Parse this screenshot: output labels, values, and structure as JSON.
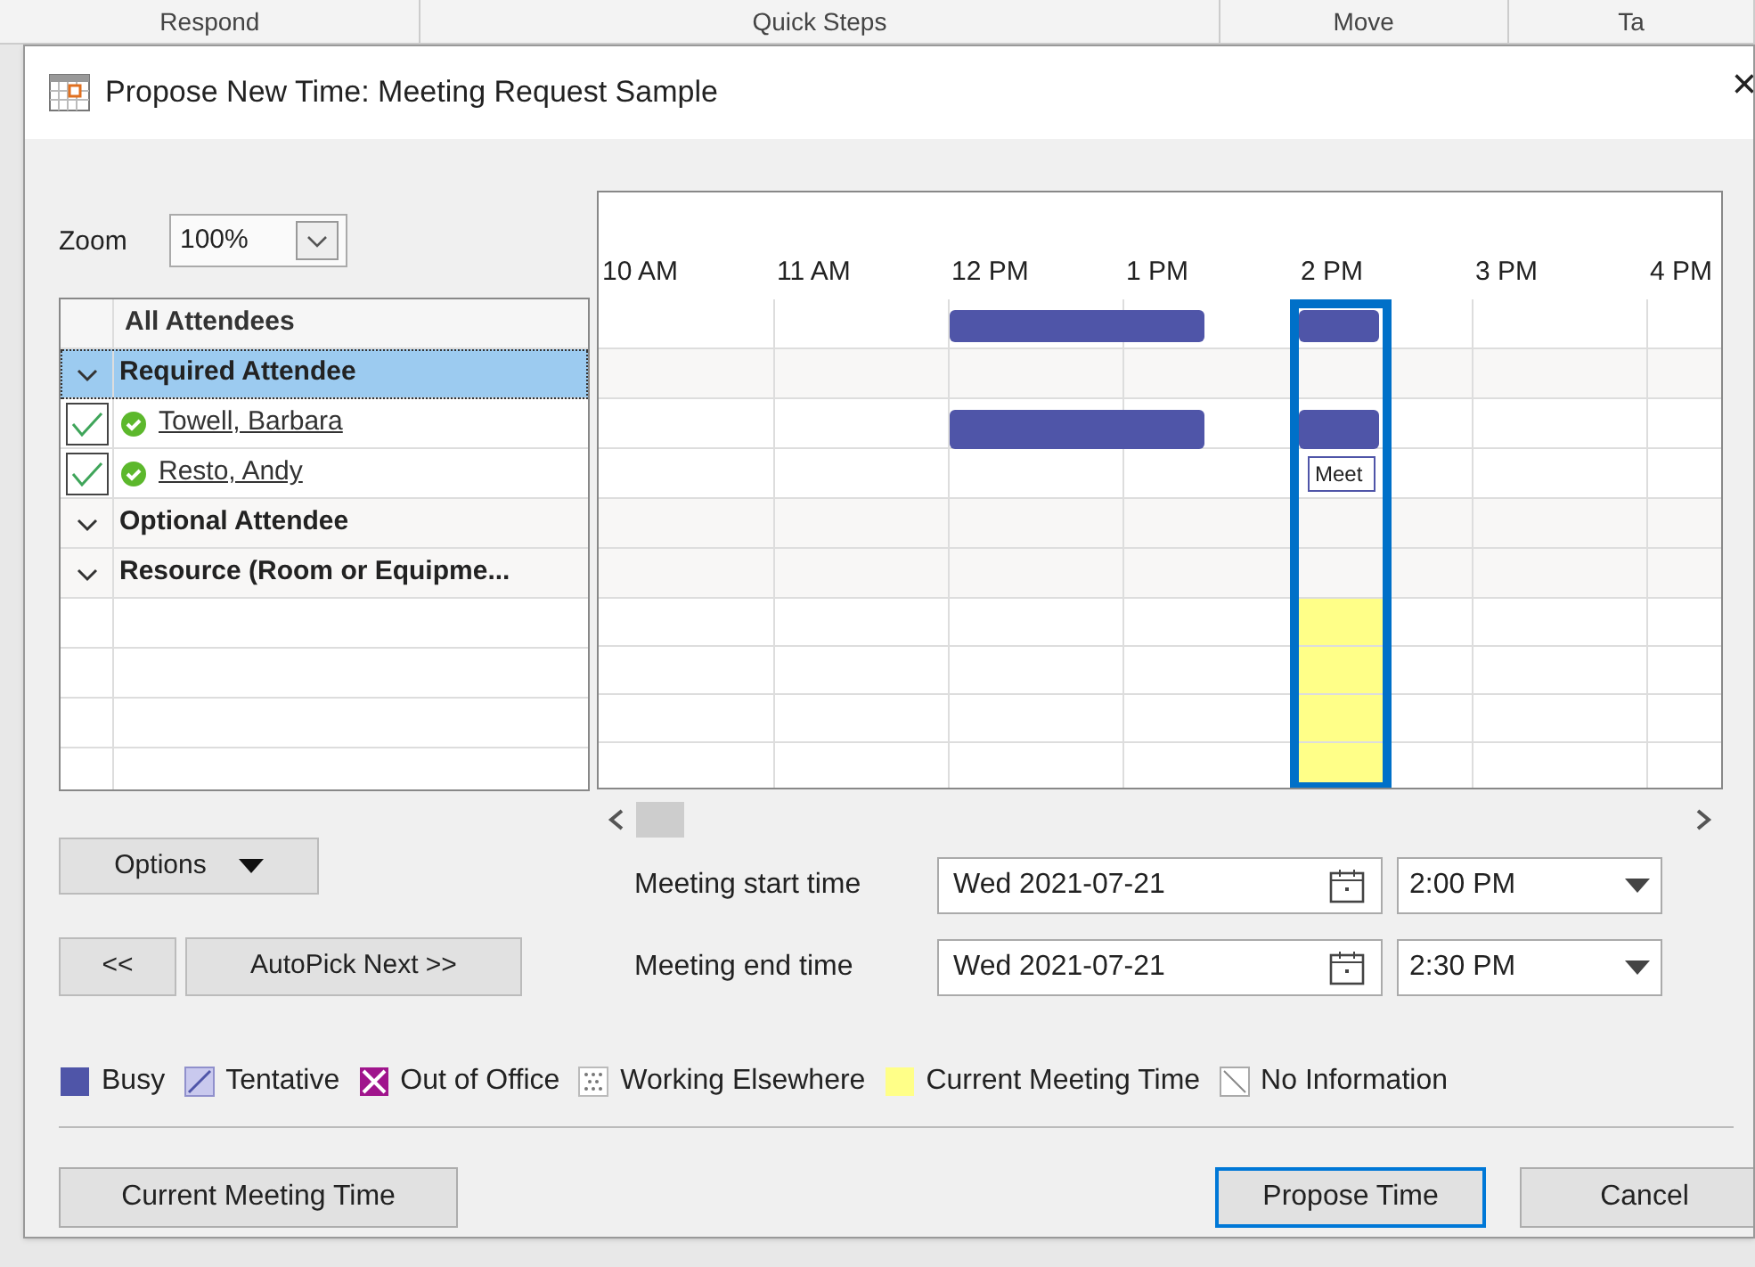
{
  "background_ribbon": [
    {
      "label": "Respond"
    },
    {
      "label": "Quick Steps"
    },
    {
      "label": "Move"
    },
    {
      "label": "Ta"
    }
  ],
  "window": {
    "title": "Propose New Time:  Meeting Request Sample",
    "close": "×"
  },
  "zoom": {
    "label": "Zoom",
    "value": "100%"
  },
  "attendees": {
    "header": "All Attendees",
    "items": [
      {
        "kind": "group",
        "label": "Required Attendee",
        "expanded": true,
        "selected": true
      },
      {
        "kind": "person",
        "label": "Towell, Barbara",
        "checked": true,
        "selected": false
      },
      {
        "kind": "person",
        "label": "Resto, Andy",
        "checked": true,
        "selected": false
      },
      {
        "kind": "group",
        "label": "Optional Attendee",
        "expanded": true,
        "selected": false
      },
      {
        "kind": "group",
        "label": "Resource (Room or Equipme...",
        "expanded": true,
        "selected": false
      }
    ]
  },
  "schedule": {
    "hours": [
      "10 AM",
      "11 AM",
      "12 PM",
      "1 PM",
      "2 PM",
      "3 PM",
      "4 PM"
    ],
    "meeting_slots": [
      false,
      false,
      false,
      false,
      false,
      false,
      false,
      false,
      true,
      false,
      false,
      false,
      false
    ],
    "rows": [
      {
        "kind": "all",
        "busy": [
          false,
          false,
          false,
          false,
          true,
          true,
          true,
          false,
          true,
          false,
          false,
          false,
          false
        ]
      },
      {
        "kind": "group",
        "busy": [
          false,
          false,
          false,
          false,
          false,
          false,
          false,
          false,
          false,
          false,
          false,
          false,
          false
        ]
      },
      {
        "kind": "person",
        "busy": [
          false,
          false,
          false,
          false,
          true,
          true,
          true,
          false,
          true,
          false,
          false,
          false,
          false
        ]
      },
      {
        "kind": "person",
        "busy": [
          false,
          false,
          false,
          false,
          false,
          false,
          false,
          false,
          false,
          false,
          false,
          false,
          false
        ],
        "tentative": [
          false,
          false,
          false,
          false,
          false,
          false,
          false,
          false,
          true,
          false,
          false,
          false,
          false
        ],
        "tentative_label": "Meet"
      },
      {
        "kind": "group",
        "busy": [
          false,
          false,
          false,
          false,
          false,
          false,
          false,
          false,
          false,
          false,
          false,
          false,
          false
        ]
      },
      {
        "kind": "group",
        "busy": [
          false,
          false,
          false,
          false,
          false,
          false,
          false,
          false,
          false,
          false,
          false,
          false,
          false
        ]
      }
    ]
  },
  "options_button": "Options",
  "prev_button": "<<",
  "autopick_button": "AutoPick Next >>",
  "start": {
    "label": "Meeting start time",
    "date": "Wed 2021-07-21",
    "time": "2:00 PM"
  },
  "end": {
    "label": "Meeting end time",
    "date": "Wed 2021-07-21",
    "time": "2:30 PM"
  },
  "legend": [
    {
      "kind": "busy",
      "label": "Busy"
    },
    {
      "kind": "tentative",
      "label": "Tentative"
    },
    {
      "kind": "oof",
      "label": "Out of Office"
    },
    {
      "kind": "elsewhere",
      "label": "Working Elsewhere"
    },
    {
      "kind": "current",
      "label": "Current Meeting Time"
    },
    {
      "kind": "noinfo",
      "label": "No Information"
    }
  ],
  "buttons": [
    {
      "label": "Current Meeting Time",
      "default": false
    },
    {
      "label": "Propose Time",
      "default": true
    },
    {
      "label": "Cancel",
      "default": false
    }
  ]
}
